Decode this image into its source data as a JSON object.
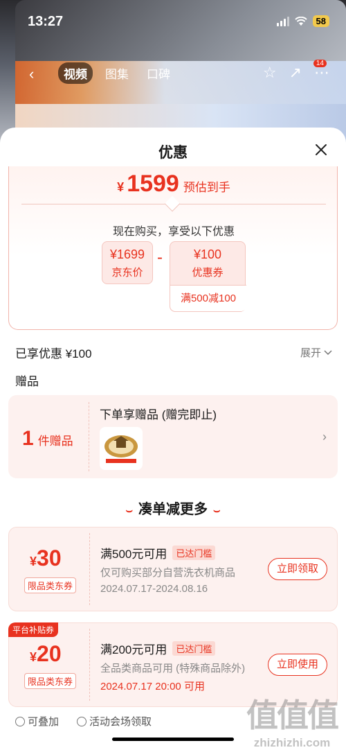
{
  "status_bar": {
    "time": "13:27",
    "battery": "58"
  },
  "media": {
    "tabs": [
      "视频",
      "图集",
      "口碑"
    ],
    "cart_badge": "14"
  },
  "sheet": {
    "title": "优惠",
    "final": {
      "currency": "¥",
      "amount": "1599",
      "label": "预估到手"
    },
    "buy_now_text": "现在购买，享受以下优惠",
    "jd_price": {
      "value": "¥1699",
      "label": "京东价"
    },
    "minus": "-",
    "coupon_price": {
      "value": "¥100",
      "label": "优惠券",
      "condition": "满500减100"
    },
    "enjoyed": "已享优惠 ¥100",
    "expand": "展开",
    "gifts_title": "赠品",
    "gift": {
      "count": "1",
      "count_unit": "件赠品",
      "title": "下单享赠品 (赠完即止)",
      "thumb_text": "实力保障·上门安装"
    },
    "more_title": "凑单减更多",
    "coupons": [
      {
        "currency": "¥",
        "amount": "30",
        "type": "限品类东券",
        "condition": "满500元可用",
        "met": "已达门槛",
        "scope": "仅可购买部分自营洗衣机商品",
        "date": "2024.07.17-2024.08.16",
        "button": "立即领取",
        "tag": ""
      },
      {
        "currency": "¥",
        "amount": "20",
        "type": "限品类东券",
        "condition": "满200元可用",
        "met": "已达门槛",
        "scope": "全品类商品可用 (特殊商品除外)",
        "date": "2024.07.17 20:00 可用",
        "button": "立即使用",
        "tag": "平台补贴券"
      }
    ],
    "footer": {
      "stackable": "可叠加",
      "venue": "活动会场领取"
    },
    "watermark": {
      "logo": "值值值",
      "url": "zhizhizhi.com"
    }
  },
  "colors": {
    "accent": "#e8321f",
    "card_bg": "#fdf1ef"
  }
}
